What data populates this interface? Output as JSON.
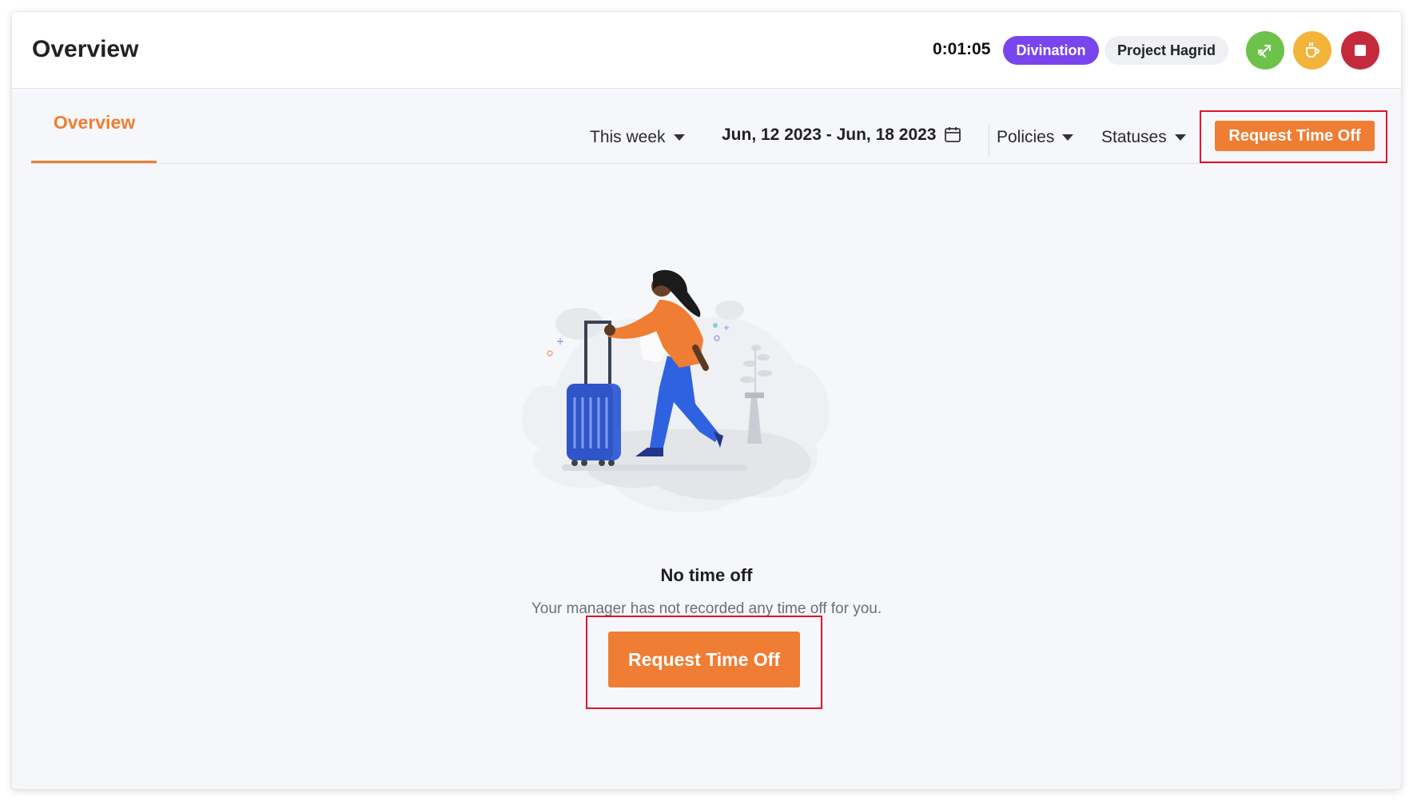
{
  "header": {
    "title": "Overview",
    "timer": "0:01:05",
    "task_pill": "Divination",
    "project_pill": "Project Hagrid",
    "actions": [
      {
        "name": "switch-task",
        "icon": "switch-arrows-icon",
        "color": "#6cc24a"
      },
      {
        "name": "take-break",
        "icon": "coffee-cup-icon",
        "color": "#f2b43a"
      },
      {
        "name": "stop-timer",
        "icon": "stop-icon",
        "color": "#c52a3c"
      }
    ]
  },
  "tabs": [
    {
      "label": "Overview",
      "active": true
    }
  ],
  "filters": {
    "period": "This week",
    "date_range": "Jun, 12 2023 - Jun, 18 2023",
    "policies": "Policies",
    "statuses": "Statuses"
  },
  "actions": {
    "request_top": "Request Time Off"
  },
  "empty_state": {
    "title": "No time off",
    "subtitle": "Your manager has not recorded any time off for you.",
    "button": "Request Time Off"
  },
  "colors": {
    "accent": "#ef7d33",
    "task_purple": "#7846ec",
    "highlight_red": "#e1122a"
  }
}
